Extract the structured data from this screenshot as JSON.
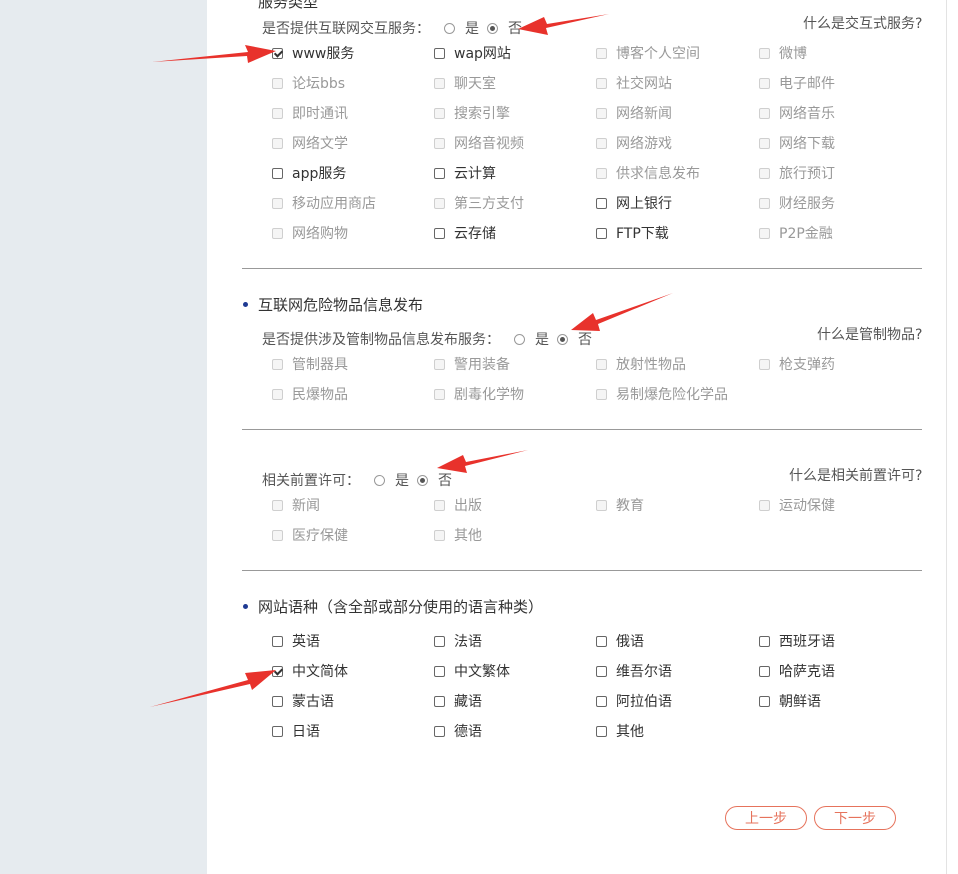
{
  "colors": {
    "sidebar_bg": "#e6ebef",
    "arrow": "#e8322c",
    "button_accent": "#e6735c",
    "bullet": "#1f3a93"
  },
  "top_cut_title": "服务类型",
  "interactive_service": {
    "question": "是否提供互联网交互服务：",
    "yes": "是",
    "no": "否",
    "selected": "否",
    "help": "什么是交互式服务?",
    "items": [
      {
        "label": "www服务",
        "checked": true,
        "enabled": true
      },
      {
        "label": "wap网站",
        "checked": false,
        "enabled": true
      },
      {
        "label": "博客个人空间",
        "checked": false,
        "enabled": false
      },
      {
        "label": "微博",
        "checked": false,
        "enabled": false
      },
      {
        "label": "论坛bbs",
        "checked": false,
        "enabled": false
      },
      {
        "label": "聊天室",
        "checked": false,
        "enabled": false
      },
      {
        "label": "社交网站",
        "checked": false,
        "enabled": false
      },
      {
        "label": "电子邮件",
        "checked": false,
        "enabled": false
      },
      {
        "label": "即时通讯",
        "checked": false,
        "enabled": false
      },
      {
        "label": "搜索引擎",
        "checked": false,
        "enabled": false
      },
      {
        "label": "网络新闻",
        "checked": false,
        "enabled": false
      },
      {
        "label": "网络音乐",
        "checked": false,
        "enabled": false
      },
      {
        "label": "网络文学",
        "checked": false,
        "enabled": false
      },
      {
        "label": "网络音视频",
        "checked": false,
        "enabled": false
      },
      {
        "label": "网络游戏",
        "checked": false,
        "enabled": false
      },
      {
        "label": "网络下载",
        "checked": false,
        "enabled": false
      },
      {
        "label": "app服务",
        "checked": false,
        "enabled": true
      },
      {
        "label": "云计算",
        "checked": false,
        "enabled": true
      },
      {
        "label": "供求信息发布",
        "checked": false,
        "enabled": false
      },
      {
        "label": "旅行预订",
        "checked": false,
        "enabled": false
      },
      {
        "label": "移动应用商店",
        "checked": false,
        "enabled": false
      },
      {
        "label": "第三方支付",
        "checked": false,
        "enabled": false
      },
      {
        "label": "网上银行",
        "checked": false,
        "enabled": true
      },
      {
        "label": "财经服务",
        "checked": false,
        "enabled": false
      },
      {
        "label": "网络购物",
        "checked": false,
        "enabled": false
      },
      {
        "label": "云存储",
        "checked": false,
        "enabled": true
      },
      {
        "label": "FTP下载",
        "checked": false,
        "enabled": true
      },
      {
        "label": "P2P金融",
        "checked": false,
        "enabled": false
      }
    ]
  },
  "dangerous_goods": {
    "title": "互联网危险物品信息发布",
    "question": "是否提供涉及管制物品信息发布服务：",
    "yes": "是",
    "no": "否",
    "selected": "否",
    "help": "什么是管制物品?",
    "items": [
      {
        "label": "管制器具",
        "checked": false,
        "enabled": false
      },
      {
        "label": "警用装备",
        "checked": false,
        "enabled": false
      },
      {
        "label": "放射性物品",
        "checked": false,
        "enabled": false
      },
      {
        "label": "枪支弹药",
        "checked": false,
        "enabled": false
      },
      {
        "label": "民爆物品",
        "checked": false,
        "enabled": false
      },
      {
        "label": "剧毒化学物",
        "checked": false,
        "enabled": false
      },
      {
        "label": "易制爆危险化学品",
        "checked": false,
        "enabled": false
      }
    ]
  },
  "pre_approval": {
    "question": "相关前置许可：",
    "yes": "是",
    "no": "否",
    "selected": "否",
    "help": "什么是相关前置许可?",
    "items": [
      {
        "label": "新闻",
        "checked": false,
        "enabled": false
      },
      {
        "label": "出版",
        "checked": false,
        "enabled": false
      },
      {
        "label": "教育",
        "checked": false,
        "enabled": false
      },
      {
        "label": "运动保健",
        "checked": false,
        "enabled": false
      },
      {
        "label": "医疗保健",
        "checked": false,
        "enabled": false
      },
      {
        "label": "其他",
        "checked": false,
        "enabled": false
      }
    ]
  },
  "languages": {
    "title": "网站语种（含全部或部分使用的语言种类）",
    "items": [
      {
        "label": "英语",
        "checked": false,
        "enabled": true
      },
      {
        "label": "法语",
        "checked": false,
        "enabled": true
      },
      {
        "label": "俄语",
        "checked": false,
        "enabled": true
      },
      {
        "label": "西班牙语",
        "checked": false,
        "enabled": true
      },
      {
        "label": "中文简体",
        "checked": true,
        "enabled": true
      },
      {
        "label": "中文繁体",
        "checked": false,
        "enabled": true
      },
      {
        "label": "维吾尔语",
        "checked": false,
        "enabled": true
      },
      {
        "label": "哈萨克语",
        "checked": false,
        "enabled": true
      },
      {
        "label": "蒙古语",
        "checked": false,
        "enabled": true
      },
      {
        "label": "藏语",
        "checked": false,
        "enabled": true
      },
      {
        "label": "阿拉伯语",
        "checked": false,
        "enabled": true
      },
      {
        "label": "朝鲜语",
        "checked": false,
        "enabled": true
      },
      {
        "label": "日语",
        "checked": false,
        "enabled": true
      },
      {
        "label": "德语",
        "checked": false,
        "enabled": true
      },
      {
        "label": "其他",
        "checked": false,
        "enabled": true
      }
    ]
  },
  "buttons": {
    "prev": "上一步",
    "next": "下一步"
  }
}
